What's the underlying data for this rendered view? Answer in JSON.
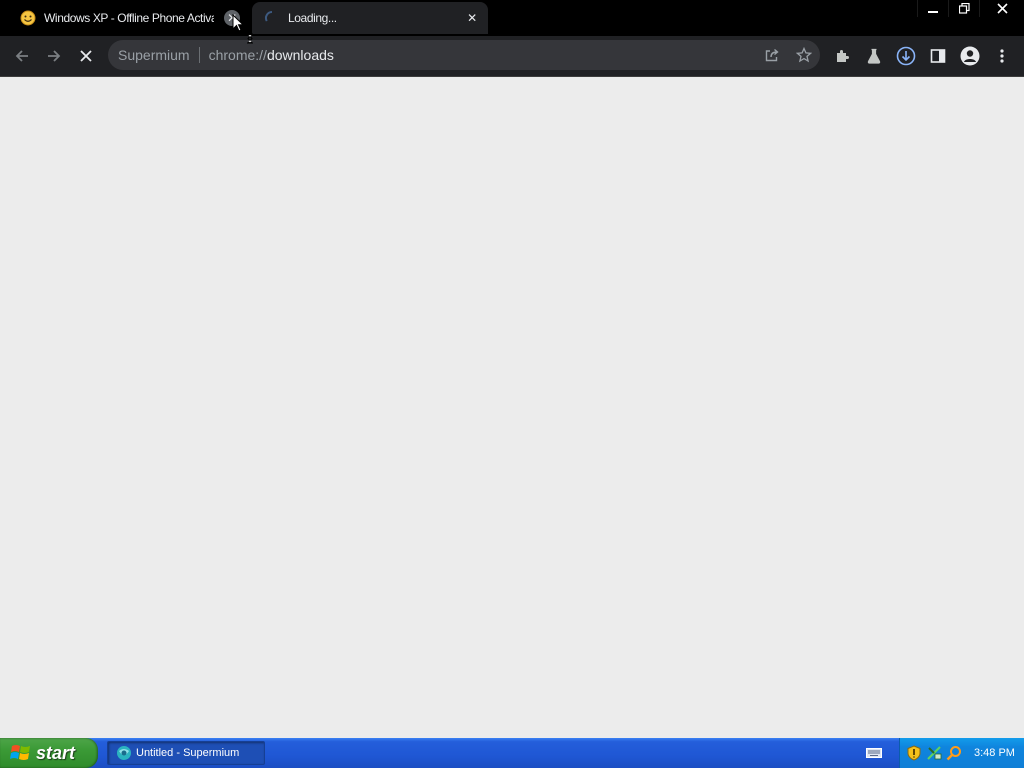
{
  "window": {
    "tabs": [
      {
        "title": "Windows XP - Offline Phone Activat",
        "close": "✕"
      },
      {
        "title": "Loading...",
        "close": "✕"
      }
    ],
    "controls": {
      "minimize": "–",
      "restore": "❐",
      "close": "✕"
    }
  },
  "toolbar": {
    "site_label": "Supermium",
    "url_scheme": "chrome://",
    "url_host": "downloads"
  },
  "taskbar": {
    "start_label": "start",
    "task_label": "Untitled - Supermium",
    "clock": "3:48 PM"
  },
  "colors": {
    "tabstrip": "#000000",
    "toolbar": "#202124",
    "omnibox": "#35363a",
    "content": "#ececec",
    "taskbar": "#245edb",
    "start": "#3b9a36",
    "download_accent": "#8ab4f8"
  }
}
